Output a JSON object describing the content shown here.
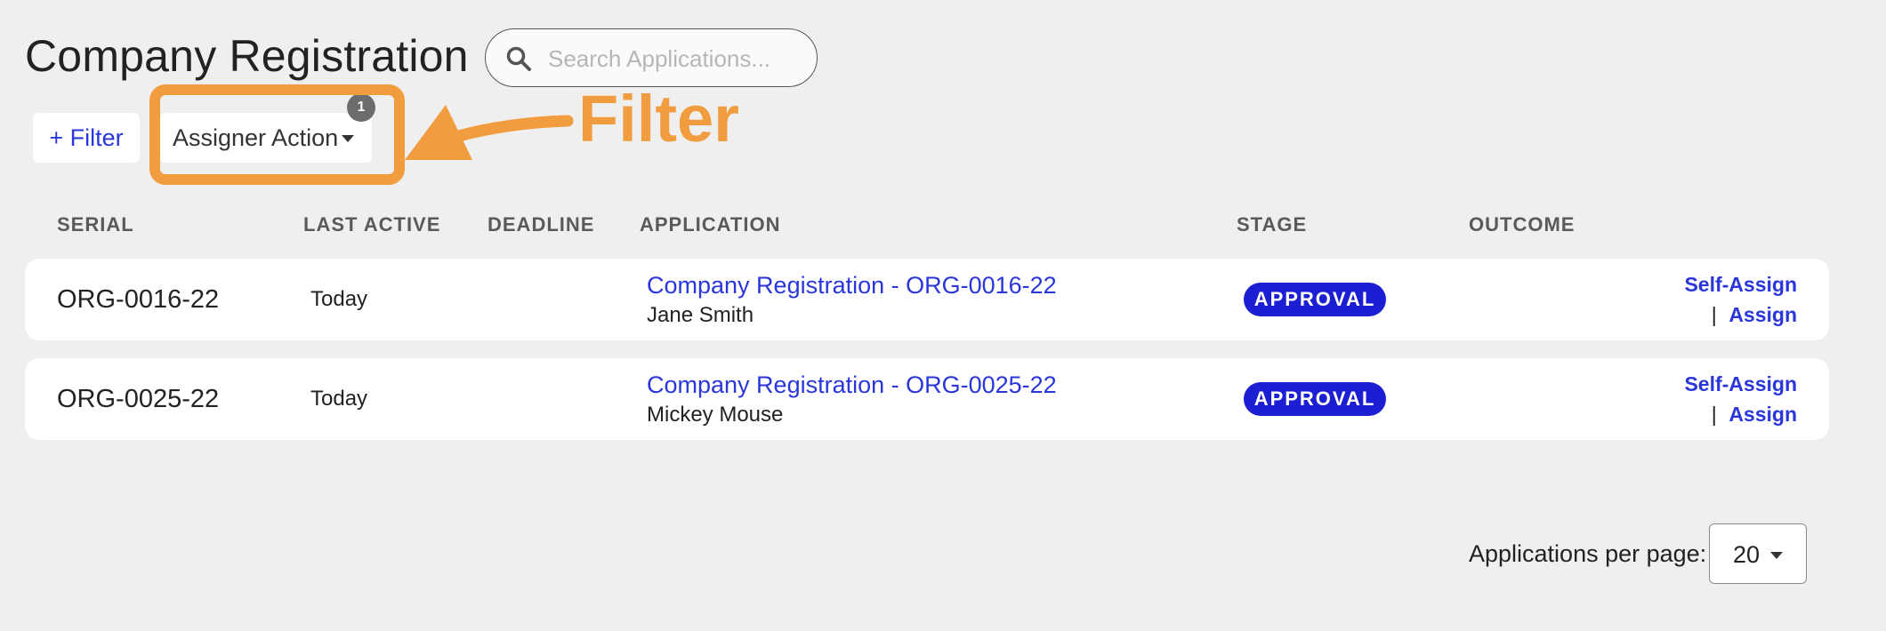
{
  "page": {
    "title": "Company Registration"
  },
  "search": {
    "placeholder": "Search Applications..."
  },
  "filters": {
    "add_filter_label": "+ Filter",
    "assigner_action_label": "Assigner Action",
    "active_count": "1"
  },
  "annotation": {
    "label": "Filter",
    "color": "#f19d3f"
  },
  "table": {
    "columns": [
      "SERIAL",
      "LAST ACTIVE",
      "DEADLINE",
      "APPLICATION",
      "STAGE",
      "OUTCOME"
    ],
    "rows": [
      {
        "serial": "ORG-0016-22",
        "last_active": "Today",
        "deadline": "",
        "application": "Company Registration - ORG-0016-22",
        "applicant": "Jane Smith",
        "stage": "APPROVAL",
        "outcome": "",
        "self_assign": "Self-Assign",
        "assign": "Assign"
      },
      {
        "serial": "ORG-0025-22",
        "last_active": "Today",
        "deadline": "",
        "application": "Company Registration - ORG-0025-22",
        "applicant": "Mickey Mouse",
        "stage": "APPROVAL",
        "outcome": "",
        "self_assign": "Self-Assign",
        "assign": "Assign"
      }
    ]
  },
  "pagination": {
    "per_page_label": "Applications per page:",
    "per_page_value": "20"
  },
  "colors": {
    "background": "#efefef",
    "link": "#2a36d9",
    "stage_badge": "#1b1ed2",
    "annotation": "#f19d3f"
  }
}
